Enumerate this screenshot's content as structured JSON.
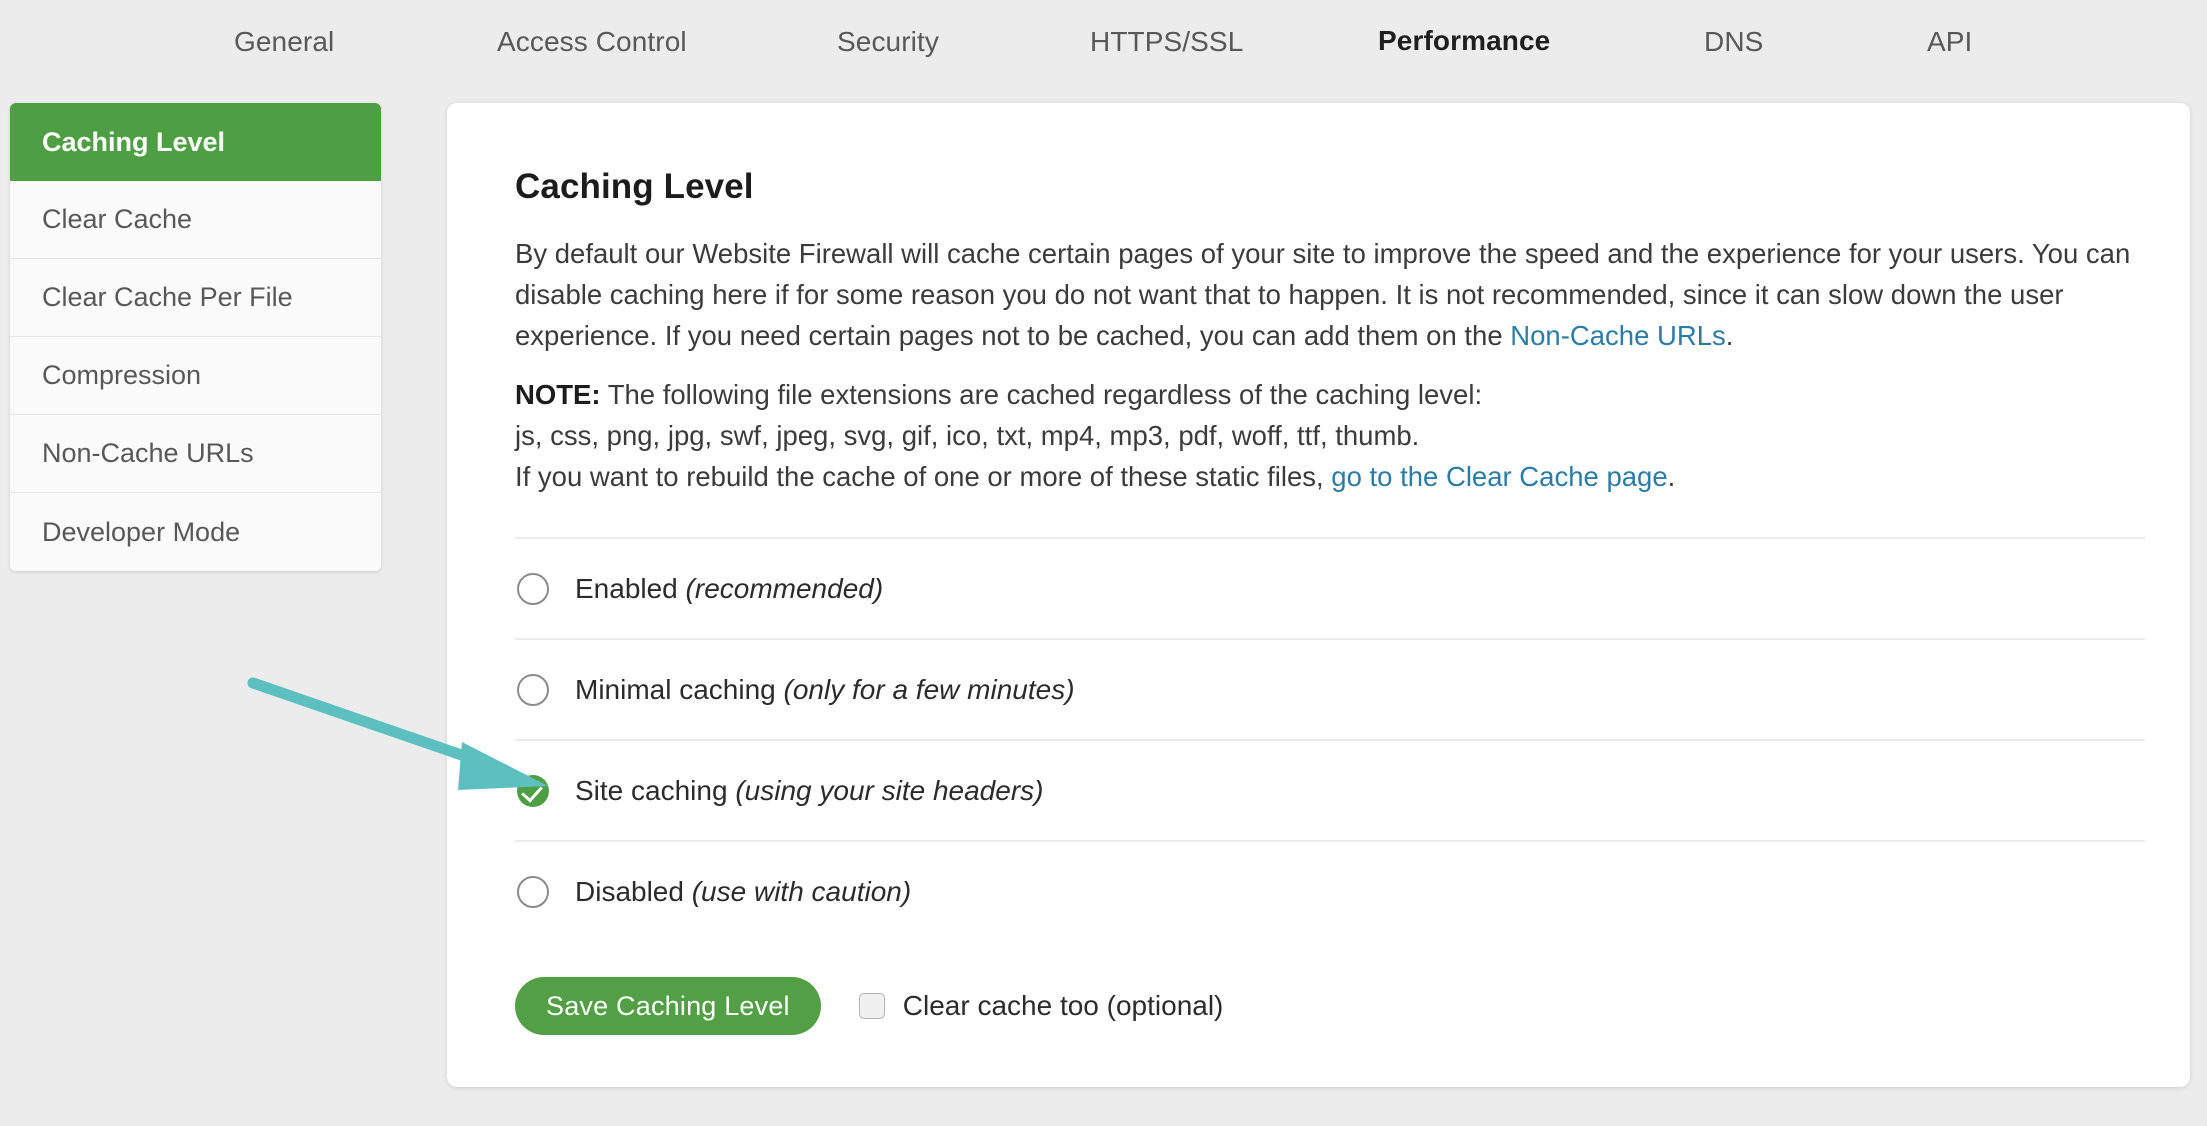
{
  "tabs": [
    {
      "label": "General",
      "active": false
    },
    {
      "label": "Access Control",
      "active": false
    },
    {
      "label": "Security",
      "active": false
    },
    {
      "label": "HTTPS/SSL",
      "active": false
    },
    {
      "label": "Performance",
      "active": true
    },
    {
      "label": "DNS",
      "active": false
    },
    {
      "label": "API",
      "active": false
    }
  ],
  "sidebar": {
    "items": [
      {
        "label": "Caching Level",
        "active": true
      },
      {
        "label": "Clear Cache",
        "active": false
      },
      {
        "label": "Clear Cache Per File",
        "active": false
      },
      {
        "label": "Compression",
        "active": false
      },
      {
        "label": "Non-Cache URLs",
        "active": false
      },
      {
        "label": "Developer Mode",
        "active": false
      }
    ]
  },
  "main": {
    "title": "Caching Level",
    "intro_part1": "By default our Website Firewall will cache certain pages of your site to improve the speed and the experience for your users. You can disable caching here if for some reason you do not want that to happen. It is not recommended, since it can slow down the user experience. If you need certain pages not to be cached, you can add them on the ",
    "intro_link": "Non-Cache URLs",
    "intro_part2": ".",
    "note_label": "NOTE:",
    "note_line1": " The following file extensions are cached regardless of the caching level:",
    "note_line2": "js, css, png, jpg, swf, jpeg, svg, gif, ico, txt, mp4, mp3, pdf, woff, ttf, thumb.",
    "note_line3_pre": "If you want to rebuild the cache of one or more of these static files, ",
    "note_line3_link": "go to the Clear Cache page",
    "note_line3_post": "."
  },
  "options": [
    {
      "name": "Enabled",
      "hint": "(recommended)",
      "checked": false
    },
    {
      "name": "Minimal caching",
      "hint": "(only for a few minutes)",
      "checked": false
    },
    {
      "name": "Site caching",
      "hint": "(using your site headers)",
      "checked": true
    },
    {
      "name": "Disabled",
      "hint": "(use with caution)",
      "checked": false
    }
  ],
  "actions": {
    "save_label": "Save Caching Level",
    "clear_cache_checkbox_label": "Clear cache too (optional)",
    "clear_cache_checked": false
  },
  "annotation": {
    "type": "arrow",
    "color": "#5cc0c0",
    "points_to": "Site caching option"
  },
  "colors": {
    "brand_green": "#4e9f43",
    "button_green": "#529f45",
    "link_blue": "#2b7ca6",
    "page_bg": "#ececec",
    "annotation_teal": "#5cc0c0"
  }
}
